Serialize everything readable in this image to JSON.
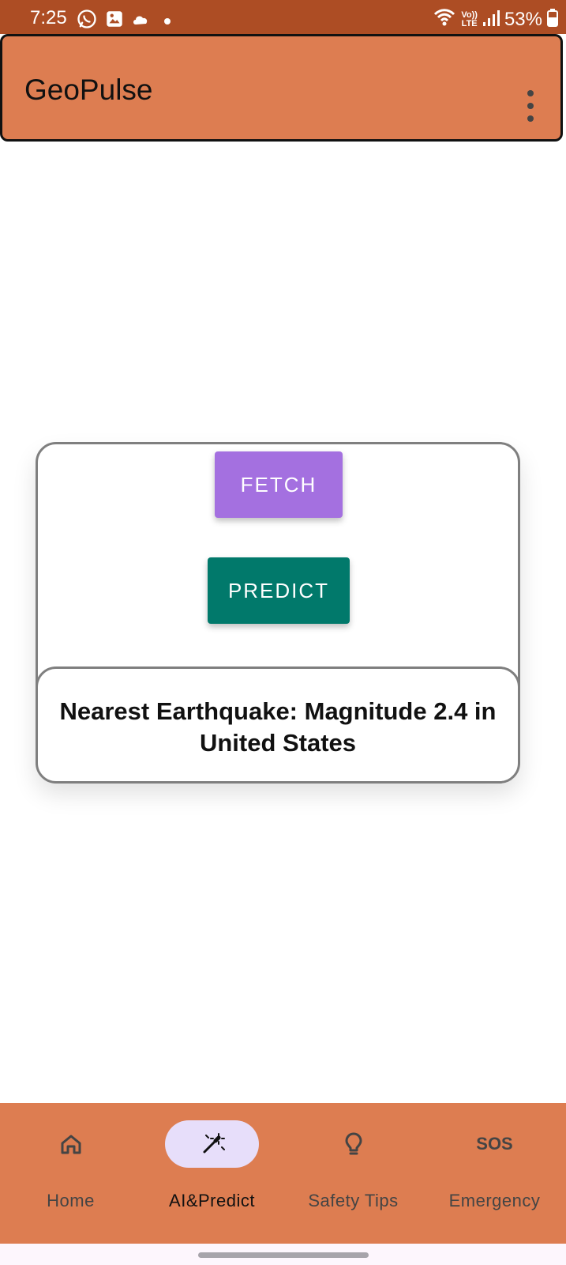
{
  "status_bar": {
    "time": "7:25",
    "battery": "53%",
    "left_icons": [
      "whatsapp-icon",
      "gallery-icon",
      "cloud-icon",
      "dot-icon"
    ],
    "right_icons": [
      "wifi-icon",
      "volte-icon",
      "signal-icon",
      "battery-icon"
    ],
    "network_badge_top": "Vo))",
    "network_badge_bottom": "LTE"
  },
  "app_bar": {
    "title": "GeoPulse",
    "more_icon": "more-vertical-icon"
  },
  "actions": {
    "fetch_label": "FETCH",
    "predict_label": "PREDICT"
  },
  "result": {
    "text": "Nearest Earthquake: Magnitude 2.4 in United States"
  },
  "bottom_nav": {
    "items": [
      {
        "label": "Home",
        "icon": "home-icon",
        "selected": false
      },
      {
        "label": "AI&Predict",
        "icon": "magic-wand-icon",
        "selected": true
      },
      {
        "label": "Safety Tips",
        "icon": "lightbulb-icon",
        "selected": false
      },
      {
        "label": "Emergency",
        "icon": "sos-icon",
        "icon_text": "SOS",
        "selected": false
      }
    ]
  },
  "colors": {
    "status_bar": "#ad4d24",
    "app_bar": "#dd7d51",
    "fetch_button": "#a470e0",
    "predict_button": "#01796b",
    "nav_active_pill": "#e7defa",
    "card_border": "#7f7f7f"
  }
}
